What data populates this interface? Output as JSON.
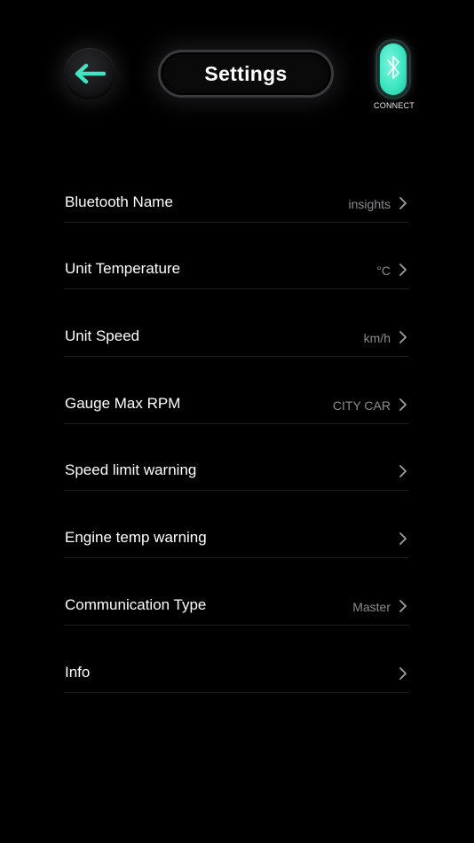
{
  "header": {
    "title": "Settings",
    "back_icon": "back-arrow-icon",
    "connect_label": "CONNECT",
    "connect_icon": "bluetooth-icon",
    "accent_color": "#3ee6c2",
    "connect_state": "on"
  },
  "settings": {
    "items": [
      {
        "label": "Bluetooth Name",
        "value": "insights"
      },
      {
        "label": "Unit Temperature",
        "value": "°C"
      },
      {
        "label": "Unit Speed",
        "value": "km/h"
      },
      {
        "label": "Gauge Max RPM",
        "value": "CITY CAR"
      },
      {
        "label": "Speed limit warning",
        "value": ""
      },
      {
        "label": "Engine temp warning",
        "value": ""
      },
      {
        "label": "Communication Type",
        "value": "Master"
      },
      {
        "label": "Info",
        "value": ""
      }
    ],
    "chevron_icon": "chevron-right-icon"
  }
}
